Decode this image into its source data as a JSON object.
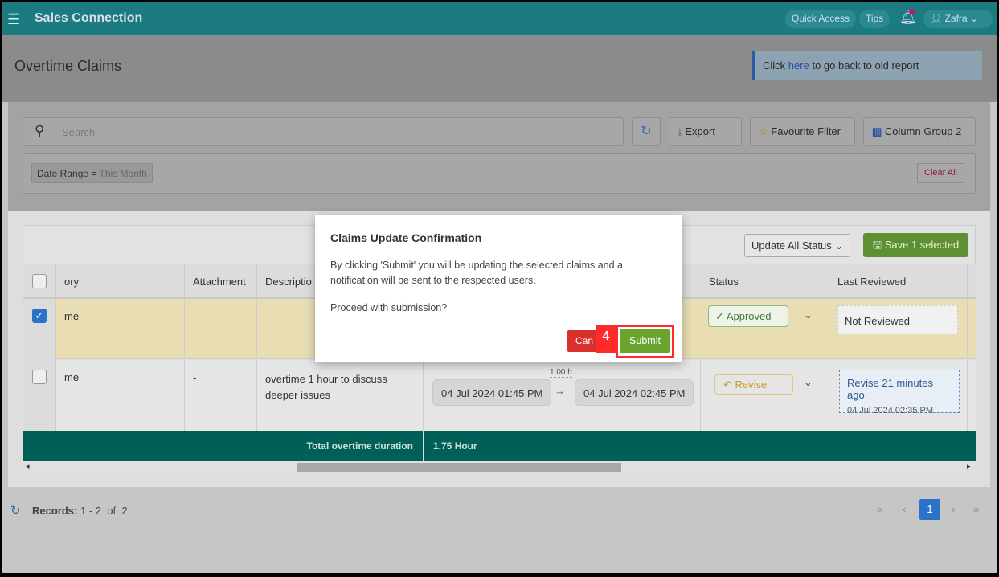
{
  "header": {
    "app_title": "Sales Connection",
    "quick_access": "Quick Access",
    "tips": "Tips",
    "user": "Zafra"
  },
  "page": {
    "title": "Overtime Claims",
    "info_prefix": "Click",
    "info_link": "here",
    "info_suffix": "to go back to old report"
  },
  "toolbar": {
    "search_placeholder": "Search",
    "export": "Export",
    "favourite_filter": "Favourite Filter",
    "column_group": "Column Group 2"
  },
  "filters": {
    "chip_label": "Date Range",
    "chip_op": "=",
    "chip_value": "This Month",
    "clear_all": "Clear All"
  },
  "table": {
    "update_all_status": "Update All Status",
    "save_selected": "Save 1 selected",
    "columns": [
      "ory",
      "Attachment",
      "Descriptio",
      "Status",
      "Last Reviewed"
    ],
    "rows": [
      {
        "checked": true,
        "category": "me",
        "attachment": "-",
        "description": "-",
        "status": "Approved",
        "last_reviewed": "Not Reviewed"
      },
      {
        "checked": false,
        "category": "me",
        "attachment": "-",
        "description": "overtime 1 hour to discuss deeper issues",
        "duration": "1.00 h",
        "start": "04 Jul 2024 01:45 PM",
        "end": "04 Jul 2024 02:45 PM",
        "status": "Revise",
        "last_reviewed": "Revise 21 minutes ago",
        "last_reviewed_date": "04 Jul 2024 02:35 PM"
      }
    ],
    "total_label": "Total overtime duration",
    "total_value": "1.75 Hour"
  },
  "footer": {
    "records_label": "Records:",
    "records_range": "1 - 2",
    "of": "of",
    "total": "2",
    "current_page": "1"
  },
  "modal": {
    "title": "Claims Update Confirmation",
    "body": "By clicking 'Submit' you will be updating the selected claims and a notification will be sent to the respected users.",
    "question": "Proceed with submission?",
    "cancel": "Can",
    "submit": "Submit",
    "step_badge": "4"
  },
  "colors": {
    "header": "#1c7b80",
    "total_row": "#006058",
    "submit": "#6aa32e",
    "cancel": "#d9302b",
    "highlight": "#ff2a2a"
  }
}
